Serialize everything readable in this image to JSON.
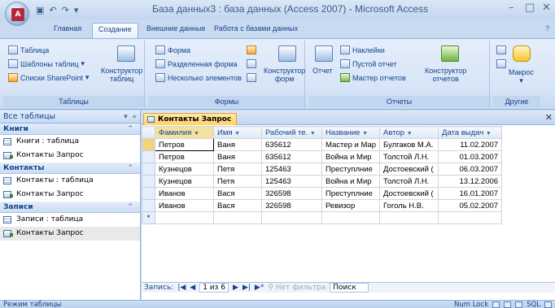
{
  "window": {
    "title": "База данных3 : база данных (Access 2007) - Microsoft Access",
    "minimize": "–",
    "maximize": "□",
    "close": "✕"
  },
  "tabs": [
    "Главная",
    "Создание",
    "Внешние данные",
    "Работа с базами данных"
  ],
  "ribbon": {
    "groups": {
      "tables": {
        "label": "Таблицы",
        "table": "Таблица",
        "templates": "Шаблоны таблиц",
        "sharepoint": "Списки SharePoint",
        "designer_1": "Конструктор",
        "designer_2": "таблиц"
      },
      "forms": {
        "label": "Формы",
        "form": "Форма",
        "split": "Разделенная форма",
        "multiple": "Несколько элементов",
        "designer_1": "Конструктор",
        "designer_2": "форм"
      },
      "reports": {
        "label": "Отчеты",
        "report": "Отчет",
        "labels": "Наклейки",
        "blank": "Пустой отчет",
        "wizard": "Мастер отчетов",
        "designer_1": "Конструктор",
        "designer_2": "отчетов"
      },
      "other": {
        "label": "Другие",
        "macro": "Макрос"
      }
    }
  },
  "nav": {
    "header": "Все таблицы",
    "groups": [
      {
        "name": "Книги",
        "items": [
          "Книги : таблица",
          "Контакты Запрос"
        ]
      },
      {
        "name": "Контакты",
        "items": [
          "Контакты : таблица",
          "Контакты Запрос"
        ]
      },
      {
        "name": "Записи",
        "items": [
          "Записи : таблица",
          "Контакты Запрос"
        ]
      }
    ]
  },
  "document": {
    "tab": "Контакты Запрос",
    "columns": [
      "Фамилия",
      "Имя",
      "Рабочий те.",
      "Название",
      "Автор",
      "Дата выдач"
    ],
    "rows": [
      [
        "Петров",
        "Ваня",
        "635612",
        "Мастер и Мар",
        "Булгаков М.А.",
        "11.02.2007"
      ],
      [
        "Петров",
        "Ваня",
        "635612",
        "Война и Мир",
        "Толстой Л.Н.",
        "01.03.2007"
      ],
      [
        "Кузнецов",
        "Петя",
        "125463",
        "Преступлние",
        "Достоевский (",
        "06.03.2007"
      ],
      [
        "Кузнецов",
        "Петя",
        "125463",
        "Война и Мир",
        "Толстой Л.Н.",
        "13.12.2006"
      ],
      [
        "Иванов",
        "Вася",
        "326598",
        "Преступлние",
        "Достоевский (",
        "16.01.2007"
      ],
      [
        "Иванов",
        "Вася",
        "326598",
        "Ревизор",
        "Гоголь Н.В.",
        "05.02.2007"
      ]
    ],
    "new_row_marker": "*"
  },
  "record_nav": {
    "label": "Запись:",
    "position": "1 из 6",
    "filter": "Нет фильтра",
    "search": "Поиск"
  },
  "status": {
    "mode": "Режим таблицы",
    "numlock": "Num Lock",
    "sql": "SQL"
  }
}
